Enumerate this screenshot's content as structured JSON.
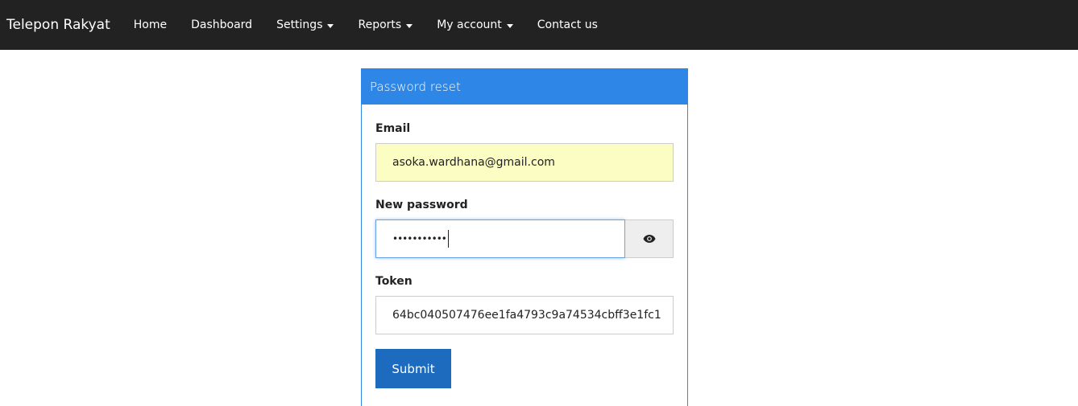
{
  "navbar": {
    "brand": "Telepon Rakyat",
    "items": [
      {
        "label": "Home",
        "dropdown": false
      },
      {
        "label": "Dashboard",
        "dropdown": false
      },
      {
        "label": "Settings",
        "dropdown": true
      },
      {
        "label": "Reports",
        "dropdown": true
      },
      {
        "label": "My account",
        "dropdown": true
      },
      {
        "label": "Contact us",
        "dropdown": false
      }
    ]
  },
  "form": {
    "title": "Password reset",
    "email": {
      "label": "Email",
      "value": "asoka.wardhana@gmail.com"
    },
    "password": {
      "label": "New password",
      "masked_value": "•••••••••••"
    },
    "token": {
      "label": "Token",
      "value": "64bc040507476ee1fa4793c9a74534cbff3e1fc1"
    },
    "submit_label": "Submit"
  },
  "icons": {
    "password_toggle": "eye-icon",
    "dropdown": "caret-down-icon"
  },
  "colors": {
    "navbar_bg": "#222222",
    "panel_accent": "#2e87e6",
    "submit_bg": "#1d6bbf",
    "autofill_bg": "#fbfdc3"
  }
}
